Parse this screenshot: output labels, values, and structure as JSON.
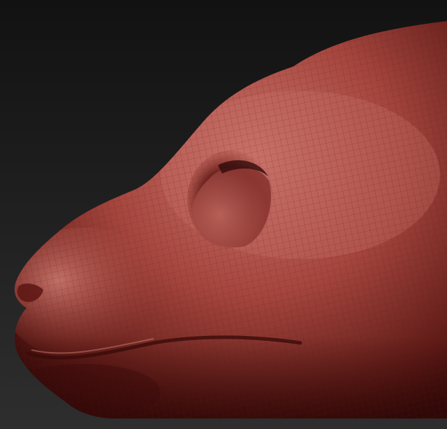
{
  "scene": {
    "subject": "head-sculpt-icon",
    "colors": {
      "background_top": "#121212",
      "background_bottom": "#2e2e2e",
      "clay_highlight": "#c9726a",
      "clay_mid": "#a5463e",
      "clay_shadow": "#5e1a16",
      "clay_dark": "#3a0c0a",
      "wire": "#5a1c18"
    }
  }
}
